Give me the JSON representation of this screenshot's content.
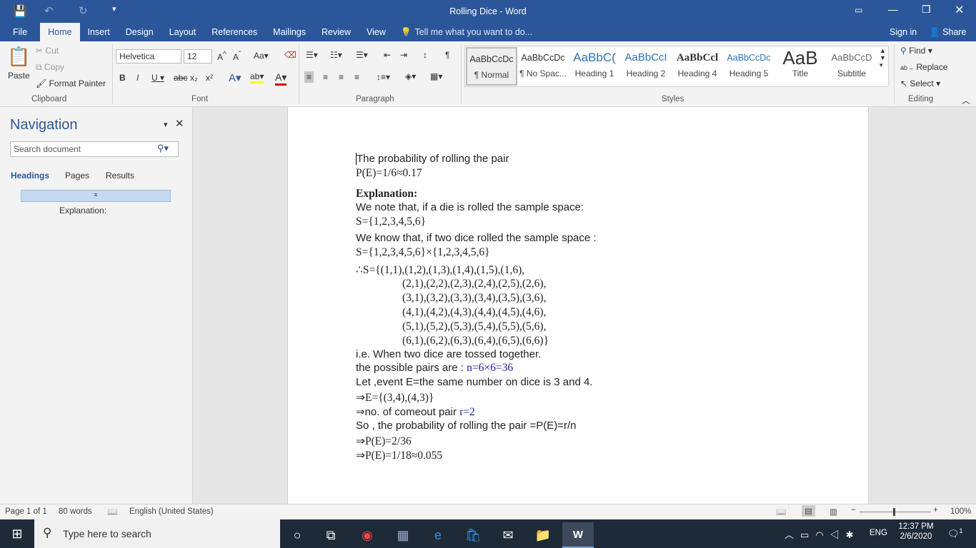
{
  "title": "Rolling Dice - Word",
  "tabs": [
    "File",
    "Home",
    "Insert",
    "Design",
    "Layout",
    "References",
    "Mailings",
    "Review",
    "View"
  ],
  "tell_me": "Tell me what you want to do...",
  "sign_in": "Sign in",
  "share": "Share",
  "clipboard": {
    "paste": "Paste",
    "cut": "Cut",
    "copy": "Copy",
    "format_painter": "Format Painter",
    "label": "Clipboard"
  },
  "font": {
    "name": "Helvetica",
    "size": "12",
    "label": "Font"
  },
  "paragraph": {
    "label": "Paragraph"
  },
  "styles": {
    "label": "Styles",
    "items": [
      {
        "preview": "AaBbCcDc",
        "name": "¶ Normal"
      },
      {
        "preview": "AaBbCcDc",
        "name": "¶ No Spac..."
      },
      {
        "preview": "AaBbC(",
        "name": "Heading 1"
      },
      {
        "preview": "AaBbCcI",
        "name": "Heading 2"
      },
      {
        "preview": "AaBbCcl",
        "name": "Heading 4"
      },
      {
        "preview": "AaBbCcDc",
        "name": "Heading 5"
      },
      {
        "preview": "AaB",
        "name": "Title"
      },
      {
        "preview": "AaBbCcD",
        "name": "Subtitle"
      }
    ]
  },
  "editing": {
    "find": "Find",
    "replace": "Replace",
    "select": "Select",
    "label": "Editing"
  },
  "navigation": {
    "title": "Navigation",
    "search_placeholder": "Search document",
    "tabs": [
      "Headings",
      "Pages",
      "Results"
    ],
    "heading_item": "Explanation:"
  },
  "document": {
    "l1": "The probability of rolling the pair",
    "l2": "P(E)=1/6≈0.17",
    "l3": "Explanation:",
    "l4": "We note that, if a die is rolled the sample space:",
    "l5": "S={1,2,3,4,5,6}",
    "l6": "We know that, if two dice rolled the sample space :",
    "l7": "S={1,2,3,4,5,6}×{1,2,3,4,5,6}",
    "m1": "∴S={(1,1),(1,2),(1,3),(1,4),(1,5),(1,6),",
    "m2": "(2,1),(2,2),(2,3),(2,4),(2,5),(2,6),",
    "m3": "(3,1),(3,2),(3,3),(3,4),(3,5),(3,6),",
    "m4": "(4,1),(4,2),(4,3),(4,4),(4,5),(4,6),",
    "m5": "(5,1),(5,2),(5,3),(5,4),(5,5),(5,6),",
    "m6": "(6,1),(6,2),(6,3),(6,4),(6,5),(6,6)}",
    "l8": "i.e. When two dice are tossed together.",
    "l9a": "the possible pairs are : ",
    "l9b": "n=6×6=36",
    "l10": "Let ,event E=the same number on dice is 3 and 4.",
    "l11": "⇒E={(3,4),(4,3)}",
    "l12a": "⇒no. of comeout pair ",
    "l12b": "r=2",
    "l13": "So , the probability of rolling the pair =P(E)=r/n",
    "l14": "⇒P(E)=2/36",
    "l15": "⇒P(E)=1/18≈0.055"
  },
  "status": {
    "page": "Page 1 of 1",
    "words": "80 words",
    "language": "English (United States)",
    "zoom": "100%"
  },
  "taskbar": {
    "search": "Type here to search",
    "lang": "ENG",
    "time": "12:37 PM",
    "date": "2/6/2020",
    "notifications": "1"
  }
}
